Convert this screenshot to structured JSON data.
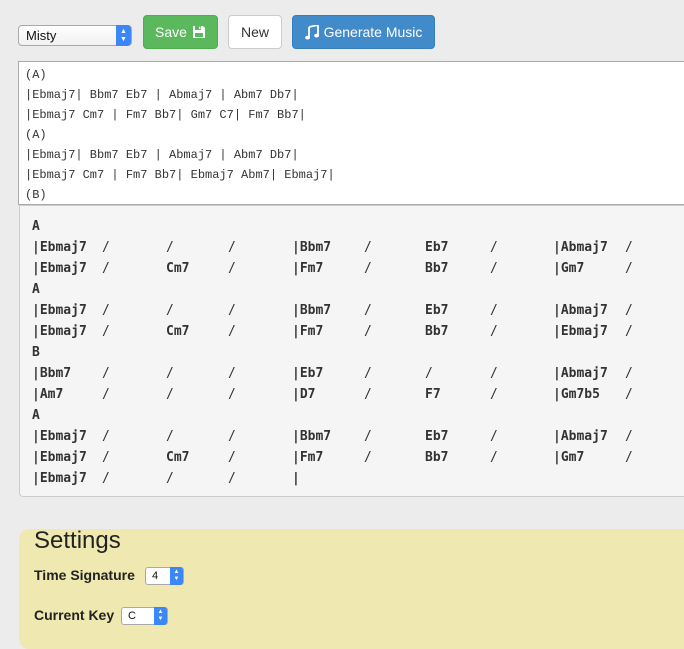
{
  "toolbar": {
    "song_select": "Misty",
    "save_label": "Save",
    "new_label": "New",
    "generate_label": "Generate Music"
  },
  "editor": {
    "lines": [
      "(A)",
      "|Ebmaj7| Bbm7 Eb7 | Abmaj7 | Abm7 Db7|",
      "|Ebmaj7 Cm7 | Fm7 Bb7| Gm7 C7| Fm7 Bb7|",
      "(A)",
      "|Ebmaj7| Bbm7 Eb7 | Abmaj7 | Abm7 Db7|",
      "|Ebmaj7 Cm7 | Fm7 Bb7| Ebmaj7 Abm7| Ebmaj7|",
      "(B)"
    ]
  },
  "chart": {
    "rows": [
      {
        "type": "section",
        "label": "A"
      },
      {
        "type": "bar",
        "cells": [
          "|Ebmaj7",
          "/",
          "/",
          "/",
          "|Bbm7",
          "/",
          "Eb7",
          "/",
          "|Abmaj7",
          "/"
        ]
      },
      {
        "type": "bar",
        "cells": [
          "|Ebmaj7",
          "/",
          "Cm7",
          "/",
          "|Fm7",
          "/",
          "Bb7",
          "/",
          "|Gm7",
          "/"
        ]
      },
      {
        "type": "section",
        "label": "A"
      },
      {
        "type": "bar",
        "cells": [
          "|Ebmaj7",
          "/",
          "/",
          "/",
          "|Bbm7",
          "/",
          "Eb7",
          "/",
          "|Abmaj7",
          "/"
        ]
      },
      {
        "type": "bar",
        "cells": [
          "|Ebmaj7",
          "/",
          "Cm7",
          "/",
          "|Fm7",
          "/",
          "Bb7",
          "/",
          "|Ebmaj7",
          "/"
        ]
      },
      {
        "type": "section",
        "label": "B"
      },
      {
        "type": "bar",
        "cells": [
          "|Bbm7",
          "/",
          "/",
          "/",
          "|Eb7",
          "/",
          "/",
          "/",
          "|Abmaj7",
          "/"
        ]
      },
      {
        "type": "bar",
        "cells": [
          "|Am7",
          "/",
          "/",
          "/",
          "|D7",
          "/",
          "F7",
          "/",
          "|Gm7b5",
          "/"
        ]
      },
      {
        "type": "section",
        "label": "A"
      },
      {
        "type": "bar",
        "cells": [
          "|Ebmaj7",
          "/",
          "/",
          "/",
          "|Bbm7",
          "/",
          "Eb7",
          "/",
          "|Abmaj7",
          "/"
        ]
      },
      {
        "type": "bar",
        "cells": [
          "|Ebmaj7",
          "/",
          "Cm7",
          "/",
          "|Fm7",
          "/",
          "Bb7",
          "/",
          "|Gm7",
          "/"
        ]
      },
      {
        "type": "bar",
        "cells": [
          "|Ebmaj7",
          "/",
          "/",
          "/",
          "|"
        ]
      }
    ]
  },
  "settings": {
    "title": "Settings",
    "time_signature_label": "Time Signature",
    "time_signature_value": "4",
    "current_key_label": "Current Key",
    "current_key_value": "C"
  },
  "icons": {
    "save": "floppy-disk-icon",
    "generate": "music-note-icon"
  },
  "colors": {
    "save_button": "#5cb85c",
    "generate_button": "#428bca",
    "settings_panel": "#efe8b0"
  }
}
